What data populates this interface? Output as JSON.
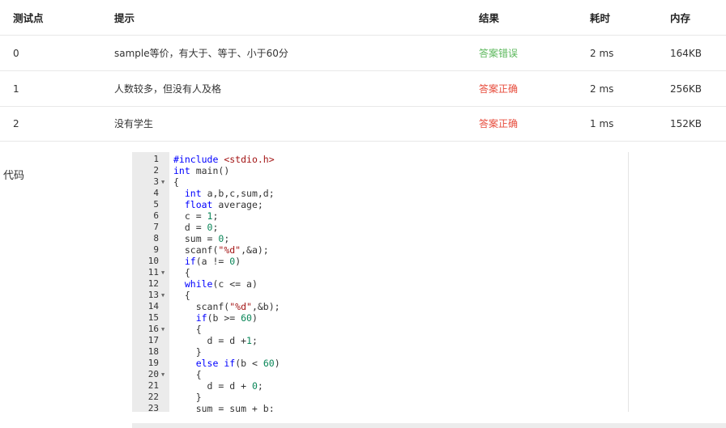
{
  "table": {
    "headers": {
      "id": "测试点",
      "hint": "提示",
      "result": "结果",
      "time": "耗时",
      "memory": "内存"
    },
    "rows": [
      {
        "id": "0",
        "hint": "sample等价，有大于、等于、小于60分",
        "result": "答案错误",
        "result_status": "wrong",
        "time": "2 ms",
        "memory": "164KB"
      },
      {
        "id": "1",
        "hint": "人数较多，但没有人及格",
        "result": "答案正确",
        "result_status": "accepted",
        "time": "2 ms",
        "memory": "256KB"
      },
      {
        "id": "2",
        "hint": "没有学生",
        "result": "答案正确",
        "result_status": "accepted",
        "time": "1 ms",
        "memory": "152KB"
      }
    ]
  },
  "code_section": {
    "label": "代码",
    "lines": [
      {
        "n": "1",
        "fold": false,
        "text": "#include <stdio.h>"
      },
      {
        "n": "2",
        "fold": false,
        "text": "int main()"
      },
      {
        "n": "3",
        "fold": true,
        "text": "{"
      },
      {
        "n": "4",
        "fold": false,
        "text": "  int a,b,c,sum,d;"
      },
      {
        "n": "5",
        "fold": false,
        "text": "  float average;"
      },
      {
        "n": "6",
        "fold": false,
        "text": "  c = 1;"
      },
      {
        "n": "7",
        "fold": false,
        "text": "  d = 0;"
      },
      {
        "n": "8",
        "fold": false,
        "text": "  sum = 0;"
      },
      {
        "n": "9",
        "fold": false,
        "text": "  scanf(\"%d\",&a);"
      },
      {
        "n": "10",
        "fold": false,
        "text": "  if(a != 0)"
      },
      {
        "n": "11",
        "fold": true,
        "text": "  {"
      },
      {
        "n": "12",
        "fold": false,
        "text": "  while(c <= a)"
      },
      {
        "n": "13",
        "fold": true,
        "text": "  {"
      },
      {
        "n": "14",
        "fold": false,
        "text": "    scanf(\"%d\",&b);"
      },
      {
        "n": "15",
        "fold": false,
        "text": "    if(b >= 60)"
      },
      {
        "n": "16",
        "fold": true,
        "text": "    {"
      },
      {
        "n": "17",
        "fold": false,
        "text": "      d = d +1;"
      },
      {
        "n": "18",
        "fold": false,
        "text": "    }"
      },
      {
        "n": "19",
        "fold": false,
        "text": "    else if(b < 60)"
      },
      {
        "n": "20",
        "fold": true,
        "text": "    {"
      },
      {
        "n": "21",
        "fold": false,
        "text": "      d = d + 0;"
      },
      {
        "n": "22",
        "fold": false,
        "text": "    }"
      },
      {
        "n": "23",
        "fold": false,
        "text": "    sum = sum + b;"
      }
    ]
  },
  "colors": {
    "accepted": "#e74c3c",
    "wrong": "#5cb85c",
    "keyword": "#0000ff",
    "string": "#a31515",
    "number": "#098658"
  },
  "icons": {
    "fold": "caret-down-icon"
  }
}
